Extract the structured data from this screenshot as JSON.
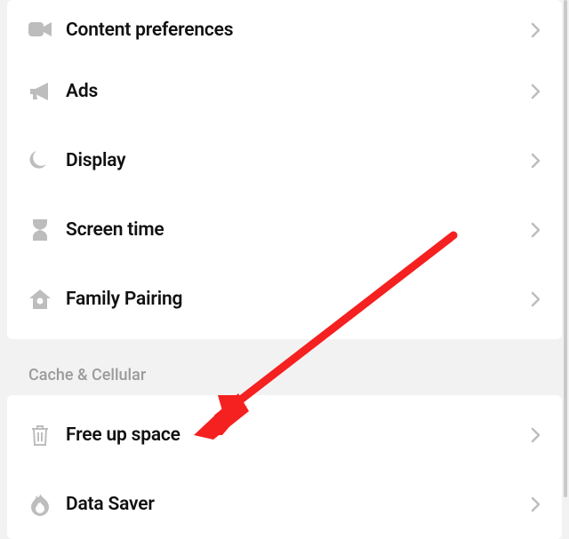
{
  "sections": [
    {
      "items": [
        {
          "icon": "camera-icon",
          "label": "Content preferences"
        },
        {
          "icon": "megaphone-icon",
          "label": "Ads"
        },
        {
          "icon": "moon-icon",
          "label": "Display"
        },
        {
          "icon": "hourglass-icon",
          "label": "Screen time"
        },
        {
          "icon": "home-icon",
          "label": "Family Pairing"
        }
      ]
    },
    {
      "header": "Cache & Cellular",
      "items": [
        {
          "icon": "trash-icon",
          "label": "Free up space"
        },
        {
          "icon": "flame-icon",
          "label": "Data Saver"
        }
      ]
    }
  ],
  "annotation": {
    "type": "arrow",
    "color": "#f52020",
    "target": "Free up space"
  }
}
